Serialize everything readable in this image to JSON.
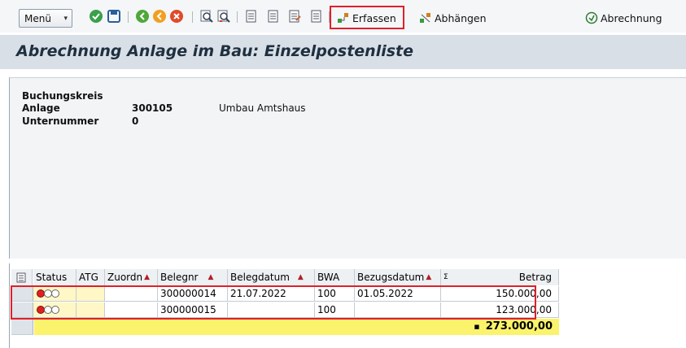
{
  "toolbar": {
    "menu_label": "Menü",
    "icons": [
      "check-icon",
      "save-icon",
      "back-icon",
      "exit-icon",
      "cancel-icon",
      "find-icon",
      "find-next-icon",
      "first-page-icon",
      "prev-page-icon",
      "next-page-icon",
      "last-page-icon"
    ],
    "erfassen_label": "Erfassen",
    "abhaengen_label": "Abhängen",
    "abrechnung_label": "Abrechnung"
  },
  "title": "Abrechnung Anlage im Bau: Einzelpostenliste",
  "header": {
    "buchungskreis_label": "Buchungskreis",
    "anlage_label": "Anlage",
    "anlage_value": "300105",
    "anlage_desc": "Umbau Amtshaus",
    "unternummer_label": "Unternummer",
    "unternummer_value": "0"
  },
  "grid": {
    "columns": [
      "Status",
      "ATG",
      "Zuordn",
      "Belegnr",
      "Belegdatum",
      "BWA",
      "Bezugsdatum",
      "Σ",
      "Betrag"
    ],
    "rows": [
      {
        "belegnr": "300000014",
        "belegdatum": "21.07.2022",
        "bwa": "100",
        "bezugsdatum": "01.05.2022",
        "betrag": "150.000,00"
      },
      {
        "belegnr": "300000015",
        "belegdatum": "",
        "bwa": "100",
        "bezugsdatum": "",
        "betrag": "123.000,00"
      }
    ],
    "total": "273.000,00",
    "total_marker": "■"
  },
  "colors": {
    "highlight": "#e0202a",
    "sum_row": "#fbf36b",
    "title_bg": "#d8dfe6"
  }
}
